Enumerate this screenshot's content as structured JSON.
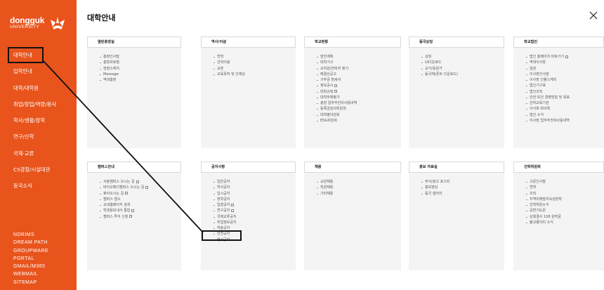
{
  "sidebar": {
    "logo": {
      "word": "dongguk",
      "sub": "UNIVERSITY"
    },
    "nav": [
      "대학안내",
      "입학안내",
      "대학/대학원",
      "취업/창업/역량/봉사",
      "학사/생활/장학",
      "연구/산학",
      "국제·교류",
      "CS광장/시설대관",
      "동국소식"
    ],
    "utilities": [
      "NDRIMS",
      "DREAM PATH",
      "GROUPWARE",
      "PORTAL",
      "GMAIL/M365",
      "WEBMAIL",
      "SITEMAP"
    ],
    "brand_color": "#e8541c"
  },
  "header": {
    "title": "대학안내",
    "close_icon": "close-icon"
  },
  "panels_top": [
    {
      "title": "열린총장실",
      "items": [
        "총장인사말",
        "총장프로필",
        "현장스케치",
        "Message",
        "역대총장"
      ]
    },
    {
      "title": "역사/이념",
      "items": [
        "연혁",
        "건학이념",
        "교훈",
        "교육목적 및 인재상"
      ]
    },
    {
      "title": "학교현황",
      "items": [
        "발전계획",
        "대학기구",
        "교직원/연락처 찾기",
        "예결산공고",
        "기부금 명세서",
        "정보공시",
        "대학규정",
        "대학자체평가",
        "총장 업무추진비사용내역",
        "등록금심의위원회",
        "대학평의원회",
        "ESG위원회"
      ]
    },
    {
      "title": "동국상징",
      "items": [
        "상징",
        "UI다운로드",
        "교가/응원가",
        "동국체(폰트 다운로드)"
      ]
    },
    {
      "title": "학교법인",
      "items": [
        "법인 홈페이지 바로가기",
        "역대이사장",
        "임원",
        "이사장인사말",
        "이사장 인물스케치",
        "법인기구표",
        "법인조직",
        "안전·보건 경영방침 및 목표",
        "산하교육기관",
        "이사회 회의록",
        "법인 소식",
        "이사장 업무추진비사용내역"
      ]
    }
  ],
  "panels_bottom": [
    {
      "title": "캠퍼스안내",
      "items": [
        "서울캠퍼스 오시는 길",
        "바이오메디캠퍼스 오시는 길",
        "찾아오시는 길",
        "캠퍼스 맵소",
        "교내홈페이지 검색",
        "학생용보내사 통합",
        "캠퍼스 투어 신청"
      ]
    },
    {
      "title": "공지사항",
      "items": [
        "일반공지",
        "학사공지",
        "입시공지",
        "장학공지",
        "입찰공지",
        "연구공지",
        "국제교류공지",
        "취업정보공지",
        "학술공지",
        "안전공지",
        "행사공지"
      ]
    },
    {
      "title": "채용",
      "items": [
        "교원채용",
        "직원채용",
        "기타채용"
      ]
    },
    {
      "title": "홍보 자료실",
      "items": [
        "주사/광고 포스터",
        "홍보영상",
        "동국 갤러리"
      ]
    },
    {
      "title": "건학위원회",
      "items": [
        "고문인사말",
        "연혁",
        "조직",
        "지역미래발자속성장학",
        "건학위원소식",
        "공방기도문",
        "상월결사 108 원력문",
        "불교종아리 소식"
      ]
    }
  ]
}
